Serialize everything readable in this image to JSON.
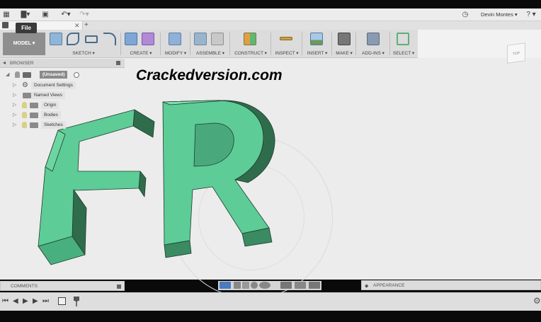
{
  "top_bar": {
    "grid_glyph": "▦",
    "file_glyph": "▇▾",
    "save_glyph": "▣",
    "undo_glyph": "↶▾",
    "redo_glyph": "↷▾",
    "clock_glyph": "◷",
    "user_name": "Devin Montes ▾",
    "help_glyph": "? ▾",
    "file_tooltip": "File"
  },
  "tabs": {
    "close_glyph": "✕",
    "new_tab_glyph": "+"
  },
  "toolbar": {
    "model_label": "MODEL ▾",
    "groups": [
      {
        "label": "SKETCH ▾"
      },
      {
        "label": "CREATE ▾"
      },
      {
        "label": "MODIFY ▾"
      },
      {
        "label": "ASSEMBLE ▾"
      },
      {
        "label": "CONSTRUCT ▾"
      },
      {
        "label": "INSPECT ▾"
      },
      {
        "label": "INSERT ▾"
      },
      {
        "label": "MAKE ▾"
      },
      {
        "label": "ADD-INS ▾"
      },
      {
        "label": "SELECT ▾"
      }
    ]
  },
  "browser": {
    "title": "BROWSER",
    "items": [
      {
        "label": "(Unsaved)"
      },
      {
        "label": "Document Settings"
      },
      {
        "label": "Named Views"
      },
      {
        "label": "Origin"
      },
      {
        "label": "Bodies"
      },
      {
        "label": "Sketches"
      }
    ]
  },
  "viewcube": {
    "face_label": "TOP"
  },
  "model": {
    "text": "FR",
    "color": "#5dcc96",
    "edge_color": "#1f3b2c"
  },
  "watermark": "Crackedversion.com",
  "panels": {
    "comments_label": "COMMENTS",
    "appearance_label": "APPEARANCE"
  },
  "timeline": {
    "first_glyph": "⏮",
    "prev_glyph": "◀",
    "play_glyph": "▶",
    "next_glyph": "▶",
    "last_glyph": "⏭",
    "settings_glyph": "⚙"
  }
}
